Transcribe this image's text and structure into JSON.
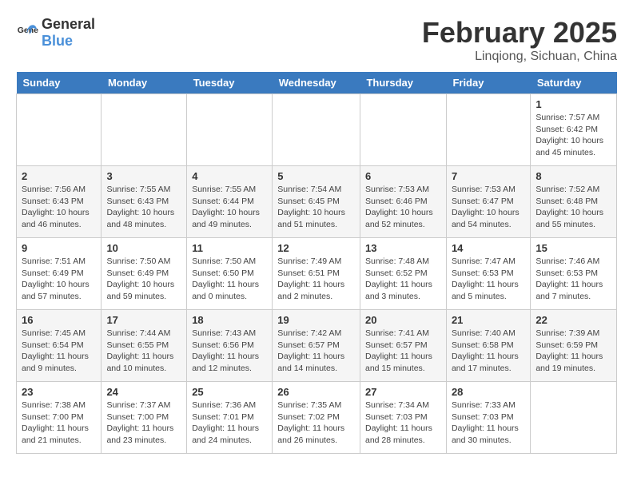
{
  "header": {
    "logo_general": "General",
    "logo_blue": "Blue",
    "month": "February 2025",
    "location": "Linqiong, Sichuan, China"
  },
  "days_of_week": [
    "Sunday",
    "Monday",
    "Tuesday",
    "Wednesday",
    "Thursday",
    "Friday",
    "Saturday"
  ],
  "weeks": [
    [
      {
        "day": "",
        "info": ""
      },
      {
        "day": "",
        "info": ""
      },
      {
        "day": "",
        "info": ""
      },
      {
        "day": "",
        "info": ""
      },
      {
        "day": "",
        "info": ""
      },
      {
        "day": "",
        "info": ""
      },
      {
        "day": "1",
        "info": "Sunrise: 7:57 AM\nSunset: 6:42 PM\nDaylight: 10 hours\nand 45 minutes."
      }
    ],
    [
      {
        "day": "2",
        "info": "Sunrise: 7:56 AM\nSunset: 6:43 PM\nDaylight: 10 hours\nand 46 minutes."
      },
      {
        "day": "3",
        "info": "Sunrise: 7:55 AM\nSunset: 6:43 PM\nDaylight: 10 hours\nand 48 minutes."
      },
      {
        "day": "4",
        "info": "Sunrise: 7:55 AM\nSunset: 6:44 PM\nDaylight: 10 hours\nand 49 minutes."
      },
      {
        "day": "5",
        "info": "Sunrise: 7:54 AM\nSunset: 6:45 PM\nDaylight: 10 hours\nand 51 minutes."
      },
      {
        "day": "6",
        "info": "Sunrise: 7:53 AM\nSunset: 6:46 PM\nDaylight: 10 hours\nand 52 minutes."
      },
      {
        "day": "7",
        "info": "Sunrise: 7:53 AM\nSunset: 6:47 PM\nDaylight: 10 hours\nand 54 minutes."
      },
      {
        "day": "8",
        "info": "Sunrise: 7:52 AM\nSunset: 6:48 PM\nDaylight: 10 hours\nand 55 minutes."
      }
    ],
    [
      {
        "day": "9",
        "info": "Sunrise: 7:51 AM\nSunset: 6:49 PM\nDaylight: 10 hours\nand 57 minutes."
      },
      {
        "day": "10",
        "info": "Sunrise: 7:50 AM\nSunset: 6:49 PM\nDaylight: 10 hours\nand 59 minutes."
      },
      {
        "day": "11",
        "info": "Sunrise: 7:50 AM\nSunset: 6:50 PM\nDaylight: 11 hours\nand 0 minutes."
      },
      {
        "day": "12",
        "info": "Sunrise: 7:49 AM\nSunset: 6:51 PM\nDaylight: 11 hours\nand 2 minutes."
      },
      {
        "day": "13",
        "info": "Sunrise: 7:48 AM\nSunset: 6:52 PM\nDaylight: 11 hours\nand 3 minutes."
      },
      {
        "day": "14",
        "info": "Sunrise: 7:47 AM\nSunset: 6:53 PM\nDaylight: 11 hours\nand 5 minutes."
      },
      {
        "day": "15",
        "info": "Sunrise: 7:46 AM\nSunset: 6:53 PM\nDaylight: 11 hours\nand 7 minutes."
      }
    ],
    [
      {
        "day": "16",
        "info": "Sunrise: 7:45 AM\nSunset: 6:54 PM\nDaylight: 11 hours\nand 9 minutes."
      },
      {
        "day": "17",
        "info": "Sunrise: 7:44 AM\nSunset: 6:55 PM\nDaylight: 11 hours\nand 10 minutes."
      },
      {
        "day": "18",
        "info": "Sunrise: 7:43 AM\nSunset: 6:56 PM\nDaylight: 11 hours\nand 12 minutes."
      },
      {
        "day": "19",
        "info": "Sunrise: 7:42 AM\nSunset: 6:57 PM\nDaylight: 11 hours\nand 14 minutes."
      },
      {
        "day": "20",
        "info": "Sunrise: 7:41 AM\nSunset: 6:57 PM\nDaylight: 11 hours\nand 15 minutes."
      },
      {
        "day": "21",
        "info": "Sunrise: 7:40 AM\nSunset: 6:58 PM\nDaylight: 11 hours\nand 17 minutes."
      },
      {
        "day": "22",
        "info": "Sunrise: 7:39 AM\nSunset: 6:59 PM\nDaylight: 11 hours\nand 19 minutes."
      }
    ],
    [
      {
        "day": "23",
        "info": "Sunrise: 7:38 AM\nSunset: 7:00 PM\nDaylight: 11 hours\nand 21 minutes."
      },
      {
        "day": "24",
        "info": "Sunrise: 7:37 AM\nSunset: 7:00 PM\nDaylight: 11 hours\nand 23 minutes."
      },
      {
        "day": "25",
        "info": "Sunrise: 7:36 AM\nSunset: 7:01 PM\nDaylight: 11 hours\nand 24 minutes."
      },
      {
        "day": "26",
        "info": "Sunrise: 7:35 AM\nSunset: 7:02 PM\nDaylight: 11 hours\nand 26 minutes."
      },
      {
        "day": "27",
        "info": "Sunrise: 7:34 AM\nSunset: 7:03 PM\nDaylight: 11 hours\nand 28 minutes."
      },
      {
        "day": "28",
        "info": "Sunrise: 7:33 AM\nSunset: 7:03 PM\nDaylight: 11 hours\nand 30 minutes."
      },
      {
        "day": "",
        "info": ""
      }
    ]
  ]
}
